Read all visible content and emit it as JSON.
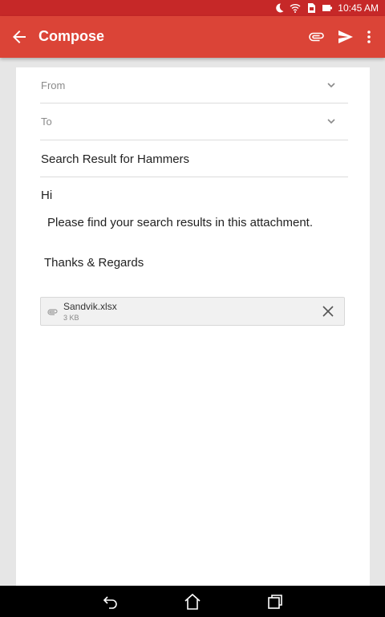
{
  "status_bar": {
    "time": "10:45 AM",
    "icons": [
      "moon-icon",
      "wifi-icon",
      "sim-card-icon",
      "battery-icon"
    ],
    "background_color": "#c62828"
  },
  "app_bar": {
    "title": "Compose",
    "background_color": "#db4437",
    "actions": [
      "attach-icon",
      "send-icon",
      "more-vert-icon"
    ]
  },
  "compose": {
    "from_label": "From",
    "to_label": "To",
    "subject": "Search Result for Hammers",
    "body": {
      "greeting": "Hi",
      "message": "Please find your search results in this attachment.",
      "closing": "Thanks & Regards"
    },
    "attachment": {
      "file_name": "Sandvik.xlsx",
      "file_size": "3 KB"
    }
  },
  "nav_bar": {
    "buttons": [
      "back-icon",
      "home-icon",
      "recents-icon"
    ]
  }
}
